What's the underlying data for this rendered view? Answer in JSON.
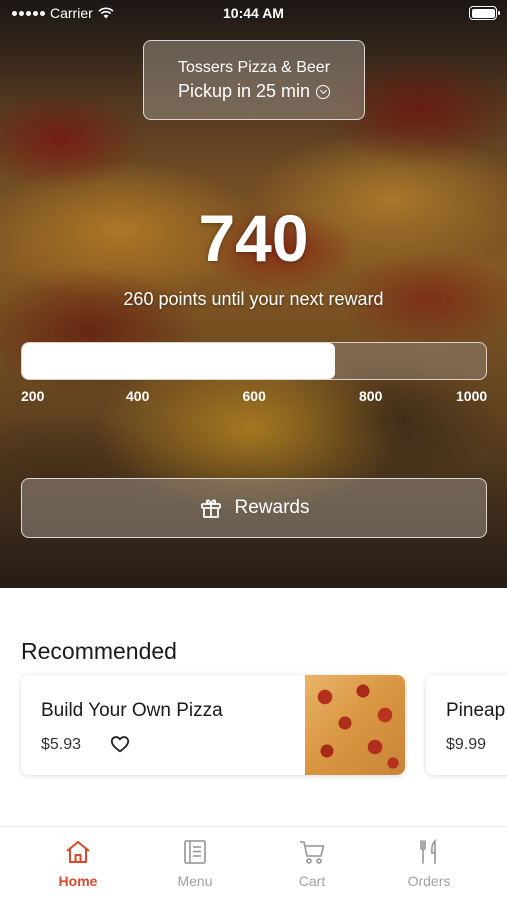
{
  "status_bar": {
    "carrier": "Carrier",
    "time": "10:44 AM"
  },
  "store": {
    "name": "Tossers Pizza & Beer",
    "pickup": "Pickup in 25 min"
  },
  "rewards": {
    "points": "740",
    "caption": "260 points until your next reward",
    "progress": {
      "min": 200,
      "max": 1000,
      "value": 740
    },
    "ticks": [
      "200",
      "400",
      "600",
      "800",
      "1000"
    ],
    "button_label": "Rewards"
  },
  "recommended": {
    "title": "Recommended",
    "items": [
      {
        "name": "Build Your Own Pizza",
        "price": "$5.93"
      },
      {
        "name": "Pineap",
        "price": "$9.99"
      }
    ]
  },
  "tabs": [
    {
      "label": "Home",
      "icon": "home-icon",
      "active": true
    },
    {
      "label": "Menu",
      "icon": "menu-book-icon",
      "active": false
    },
    {
      "label": "Cart",
      "icon": "cart-icon",
      "active": false
    },
    {
      "label": "Orders",
      "icon": "fork-knife-icon",
      "active": false
    }
  ],
  "colors": {
    "accent": "#d9482b",
    "inactive_tab": "#a0a0a0"
  }
}
